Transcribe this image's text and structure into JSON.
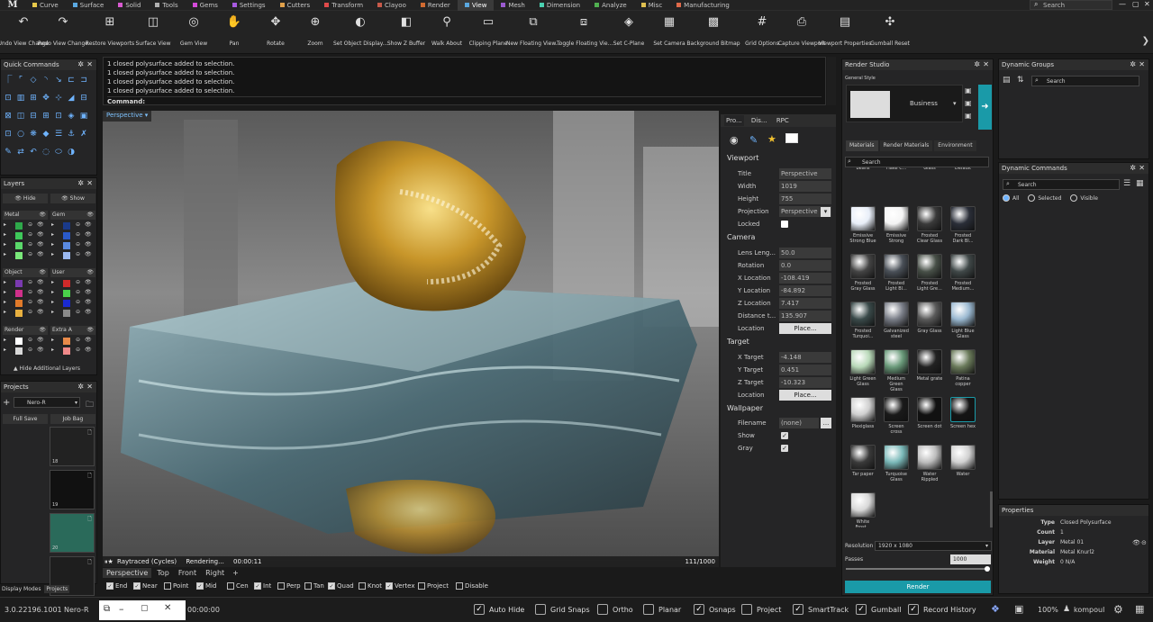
{
  "menubar": {
    "logo": "M",
    "tabs": [
      {
        "label": "Curve",
        "color": "#e6c84a"
      },
      {
        "label": "Surface",
        "color": "#5aa8e0"
      },
      {
        "label": "Solid",
        "color": "#d85ad0"
      },
      {
        "label": "Tools",
        "color": "#b0b0b0"
      },
      {
        "label": "Gems",
        "color": "#d34ad8"
      },
      {
        "label": "Settings",
        "color": "#a85ae0"
      },
      {
        "label": "Cutters",
        "color": "#e0a04a"
      },
      {
        "label": "Transform",
        "color": "#e04a4a"
      },
      {
        "label": "Clayoo",
        "color": "#c85a4a"
      },
      {
        "label": "Render",
        "color": "#d06a30"
      },
      {
        "label": "View",
        "color": "#5aa8e0"
      },
      {
        "label": "Mesh",
        "color": "#9a5ad0"
      },
      {
        "label": "Dimension",
        "color": "#4ad0b0"
      },
      {
        "label": "Analyze",
        "color": "#50b050"
      },
      {
        "label": "Misc",
        "color": "#e0c050"
      },
      {
        "label": "Manufacturing",
        "color": "#e06a4a"
      }
    ],
    "active_index": 10,
    "search_placeholder": "Search"
  },
  "toolbar": {
    "tools": [
      {
        "label": "Undo View Change",
        "icon": "undo-view-icon"
      },
      {
        "label": "Redo View Change",
        "icon": "redo-view-icon"
      },
      {
        "label": "Restore Viewports",
        "icon": "restore-viewports-icon"
      },
      {
        "label": "Surface View",
        "icon": "surface-view-icon"
      },
      {
        "label": "Gem View",
        "icon": "gem-view-icon"
      },
      {
        "label": "Pan",
        "icon": "pan-icon"
      },
      {
        "label": "Rotate",
        "icon": "rotate-icon"
      },
      {
        "label": "Zoom",
        "icon": "zoom-icon"
      },
      {
        "label": "Set Object Display...",
        "icon": "object-display-icon"
      },
      {
        "label": "Show Z Buffer",
        "icon": "z-buffer-icon"
      },
      {
        "label": "Walk About",
        "icon": "walk-about-icon"
      },
      {
        "label": "Clipping Plane",
        "icon": "clipping-plane-icon"
      },
      {
        "label": "New Floating View...",
        "icon": "floating-view-icon"
      },
      {
        "label": "Toggle Floating Vie...",
        "icon": "toggle-floating-icon"
      },
      {
        "label": "Set C-Plane",
        "icon": "cplane-icon"
      },
      {
        "label": "Set Camera",
        "icon": "camera-icon"
      },
      {
        "label": "Background Bitmap",
        "icon": "bitmap-icon"
      },
      {
        "label": "Grid Options",
        "icon": "grid-icon"
      },
      {
        "label": "Capture Viewport",
        "icon": "capture-icon"
      },
      {
        "label": "Viewport Properties",
        "icon": "viewport-props-icon"
      },
      {
        "label": "Gumball Reset",
        "icon": "gumball-icon"
      }
    ]
  },
  "quick_commands": {
    "title": "Quick Commands"
  },
  "layers": {
    "title": "Layers",
    "hide_label": "Hide",
    "show_label": "Show",
    "groups_left": [
      {
        "name": "Metal",
        "colors": [
          "#2ea84a",
          "#3ec85a",
          "#5ad86a",
          "#7ae87a"
        ]
      },
      {
        "name": "Object",
        "colors": [
          "#7a3ab0",
          "#d0308a",
          "#e07a2a",
          "#e8b040"
        ]
      },
      {
        "name": "Render",
        "colors": [
          "#ffffff",
          "#d8d8d8"
        ]
      }
    ],
    "groups_right": [
      {
        "name": "Gem",
        "colors": [
          "#1a3a8a",
          "#2a5ac8",
          "#5a8ae0",
          "#9ab8f0"
        ]
      },
      {
        "name": "User",
        "colors": [
          "#d02a2a",
          "#4ad04a",
          "#1a2ad0",
          "#8a8a8a"
        ]
      },
      {
        "name": "Extra A",
        "colors": [
          "#e88a4a",
          "#f08a8a"
        ]
      }
    ],
    "hide_additional": "Hide Additional Layers"
  },
  "projects": {
    "title": "Projects",
    "current": "Nero-R",
    "full_save": "Full Save",
    "job_bag": "Job Bag",
    "thumbs": [
      {
        "num": "18"
      },
      {
        "num": "19"
      },
      {
        "num": "20"
      },
      {
        "num": "Blank"
      }
    ]
  },
  "command": {
    "history": [
      "1 closed polysurface added to selection.",
      "1 closed polysurface added to selection.",
      "1 closed polysurface added to selection.",
      "1 closed polysurface added to selection."
    ],
    "prompt": "Command:"
  },
  "viewport": {
    "name": "Perspective",
    "status": "Raytraced (Cycles)",
    "rendering": "Rendering...",
    "time": "00:00:11",
    "passes": "111/1000",
    "tabs": [
      "Perspective",
      "Top",
      "Front",
      "Right"
    ],
    "add_tab": "+"
  },
  "properties_panel": {
    "tabs": [
      "Pro...",
      "Dis...",
      "RPC"
    ],
    "viewport_title": "Viewport",
    "title_label": "Title",
    "title_value": "Perspective",
    "width_label": "Width",
    "width_value": "1019",
    "height_label": "Height",
    "height_value": "755",
    "projection_label": "Projection",
    "projection_value": "Perspective",
    "locked_label": "Locked",
    "camera_title": "Camera",
    "lens_label": "Lens Leng...",
    "lens_value": "50.0",
    "rotation_label": "Rotation",
    "rotation_value": "0.0",
    "xloc_label": "X Location",
    "xloc_value": "-108.419",
    "yloc_label": "Y Location",
    "yloc_value": "-84.892",
    "zloc_label": "Z Location",
    "zloc_value": "7.417",
    "dist_label": "Distance t...",
    "dist_value": "135.907",
    "location_label": "Location",
    "place_label": "Place...",
    "target_title": "Target",
    "xt_label": "X Target",
    "xt_value": "-4.148",
    "yt_label": "Y Target",
    "yt_value": "0.451",
    "zt_label": "Z Target",
    "zt_value": "-10.323",
    "wallpaper_title": "Wallpaper",
    "filename_label": "Filename",
    "filename_value": "(none)",
    "browse": "...",
    "show_label": "Show",
    "gray_label": "Gray"
  },
  "render_studio": {
    "title": "Render Studio",
    "general_style": "General Style",
    "style": "Business",
    "tabs": [
      "Materials",
      "Render Materials",
      "Environment"
    ],
    "search_placeholder": "Search",
    "materials": [
      {
        "name": "Coffee beans",
        "c": "#6a4a2a"
      },
      {
        "name": "Colored Flake C...",
        "c": "#8a8a9a"
      },
      {
        "name": "Dark Blue Glass",
        "c": "#1a2a4a"
      },
      {
        "name": "Emissive Default",
        "c": "#dddddd"
      },
      {
        "name": "Emissive Strong Blue",
        "c": "#e8eef8"
      },
      {
        "name": "Emissive Strong",
        "c": "#f4f4f4"
      },
      {
        "name": "Frosted Clear Glass",
        "c": "#3a3a3a"
      },
      {
        "name": "Frosted Dark Bl...",
        "c": "#2a2e38"
      },
      {
        "name": "Frosted Gray Glass",
        "c": "#444"
      },
      {
        "name": "Frosted Light Bl...",
        "c": "#4a5058"
      },
      {
        "name": "Frosted Light Gre...",
        "c": "#485048"
      },
      {
        "name": "Frosted Medium...",
        "c": "#404848"
      },
      {
        "name": "Frosted Turquoi...",
        "c": "#3a4a4a"
      },
      {
        "name": "Galvanized steel",
        "c": "#7a7e88"
      },
      {
        "name": "Gray Glass",
        "c": "#5a5a5a"
      },
      {
        "name": "Light Blue Glass",
        "c": "#9ab8d0"
      },
      {
        "name": "Light Green Glass",
        "c": "#b8d8b8"
      },
      {
        "name": "Medium Green Glass",
        "c": "#6a9a7a"
      },
      {
        "name": "Metal grate",
        "c": "#222"
      },
      {
        "name": "Patina copper",
        "c": "#6a7a5a"
      },
      {
        "name": "Plexiglass",
        "c": "#cfcfcf"
      },
      {
        "name": "Screen cross",
        "c": "#1a1a1a"
      },
      {
        "name": "Screen dot",
        "c": "#111"
      },
      {
        "name": "Screen hex",
        "c": "#151515"
      },
      {
        "name": "Tar paper",
        "c": "#3a3a3a"
      },
      {
        "name": "Turquoise Glass",
        "c": "#7ab8b8"
      },
      {
        "name": "Water Rippled",
        "c": "#bcbcbc"
      },
      {
        "name": "Water",
        "c": "#d0d0d0"
      },
      {
        "name": "White Frost...",
        "c": "#d8d8d8"
      }
    ],
    "resolution_label": "Resolution",
    "resolution_value": "1920 x 1080",
    "passes_label": "Passes",
    "passes_value": "1000",
    "render_button": "Render"
  },
  "dynamic_groups": {
    "title": "Dynamic Groups",
    "search_placeholder": "Search"
  },
  "dynamic_commands": {
    "title": "Dynamic Commands",
    "search_placeholder": "Search",
    "options": [
      "All",
      "Selected",
      "Visible"
    ]
  },
  "obj_properties": {
    "title": "Properties",
    "type_label": "Type",
    "type_value": "Closed Polysurface",
    "count_label": "Count",
    "count_value": "1",
    "layer_label": "Layer",
    "layer_value": "Metal 01",
    "material_label": "Material",
    "material_value": "Metal Knurl2",
    "weight_label": "Weight",
    "weight_value": "0 N/A"
  },
  "osnaps": [
    {
      "label": "End",
      "on": true
    },
    {
      "label": "Near",
      "on": true
    },
    {
      "label": "Point",
      "on": false
    },
    {
      "label": "Mid",
      "on": true
    },
    {
      "label": "Cen",
      "on": false
    },
    {
      "label": "Int",
      "on": true
    },
    {
      "label": "Perp",
      "on": false
    },
    {
      "label": "Tan",
      "on": false
    },
    {
      "label": "Quad",
      "on": true
    },
    {
      "label": "Knot",
      "on": false
    },
    {
      "label": "Vertex",
      "on": true
    },
    {
      "label": "Project",
      "on": false
    },
    {
      "label": "Disable",
      "on": false
    }
  ],
  "display_modes_tab": "Display Modes",
  "projects_tab": "Projects",
  "statusbar": {
    "version": "3.0.22196.1001",
    "project": "Nero-R",
    "time": "00:00:00",
    "toggles": [
      {
        "label": "Auto Hide",
        "on": true
      },
      {
        "label": "Grid Snaps",
        "on": false
      },
      {
        "label": "Ortho",
        "on": false
      },
      {
        "label": "Planar",
        "on": false
      },
      {
        "label": "Osnaps",
        "on": true
      },
      {
        "label": "Project",
        "on": false
      },
      {
        "label": "SmartTrack",
        "on": true
      },
      {
        "label": "Gumball",
        "on": true
      },
      {
        "label": "Record History",
        "on": true
      }
    ],
    "zoom": "100%",
    "user": "kompoul"
  }
}
